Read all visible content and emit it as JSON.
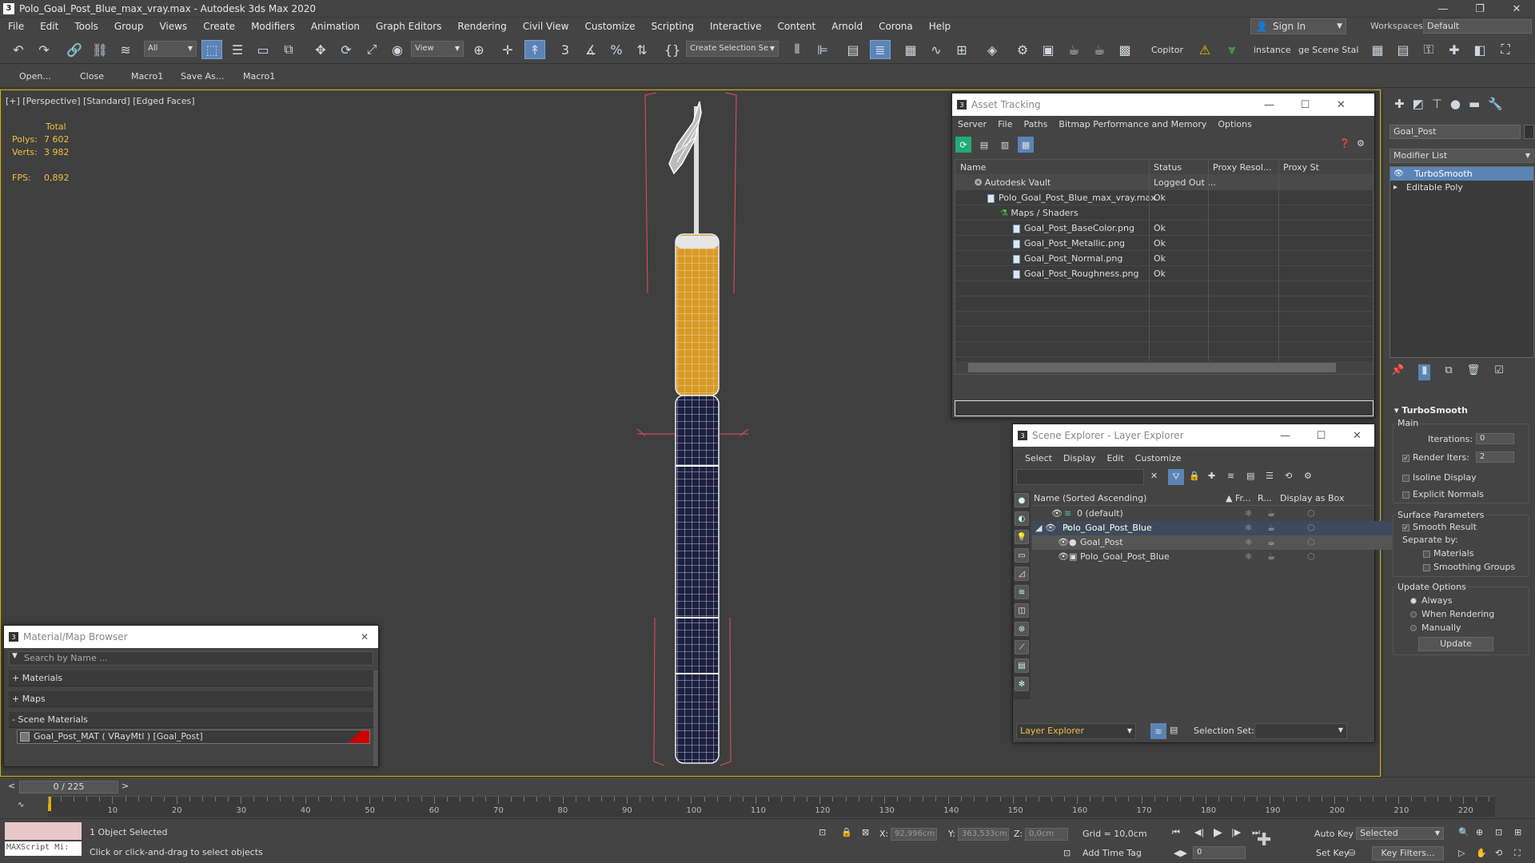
{
  "window": {
    "title": "Polo_Goal_Post_Blue_max_vray.max - Autodesk 3ds Max 2020",
    "app_icon": "3"
  },
  "menu": [
    "File",
    "Edit",
    "Tools",
    "Group",
    "Views",
    "Create",
    "Modifiers",
    "Animation",
    "Graph Editors",
    "Rendering",
    "Civil View",
    "Customize",
    "Scripting",
    "Interactive",
    "Content",
    "Arnold",
    "Corona",
    "Help"
  ],
  "signin": {
    "label": "Sign In"
  },
  "workspaces": {
    "label": "Workspaces:",
    "value": "Default"
  },
  "toolbar": {
    "filter": "All",
    "view": "View",
    "selection_set": "Create Selection Se",
    "copitor": "Copitor",
    "instance": "instance",
    "scene_stat": "ge Scene Stal"
  },
  "toolbar2": [
    "Open...",
    "Close",
    "Macro1",
    "Save As...",
    "Macro1"
  ],
  "viewport": {
    "label": "[+] [Perspective] [Standard] [Edged Faces]",
    "stats": {
      "total_label": "Total",
      "polys_label": "Polys:",
      "polys": "7 602",
      "verts_label": "Verts:",
      "verts": "3 982",
      "fps_label": "FPS:",
      "fps": "0,892"
    }
  },
  "asset_tracking": {
    "title": "Asset Tracking",
    "menu": [
      "Server",
      "File",
      "Paths",
      "Bitmap Performance and Memory",
      "Options"
    ],
    "columns": [
      "Name",
      "Status",
      "Proxy Resol...",
      "Proxy St"
    ],
    "rows": [
      {
        "name": "Autodesk Vault",
        "status": "Logged Out ...",
        "indent": 0
      },
      {
        "name": "Polo_Goal_Post_Blue_max_vray.max",
        "status": "Ok",
        "indent": 1
      },
      {
        "name": "Maps / Shaders",
        "status": "",
        "indent": 2
      },
      {
        "name": "Goal_Post_BaseColor.png",
        "status": "Ok",
        "indent": 3
      },
      {
        "name": "Goal_Post_Metallic.png",
        "status": "Ok",
        "indent": 3
      },
      {
        "name": "Goal_Post_Normal.png",
        "status": "Ok",
        "indent": 3
      },
      {
        "name": "Goal_Post_Roughness.png",
        "status": "Ok",
        "indent": 3
      }
    ]
  },
  "scene_explorer": {
    "title": "Scene Explorer - Layer Explorer",
    "menu": [
      "Select",
      "Display",
      "Edit",
      "Customize"
    ],
    "columns": [
      "Name (Sorted Ascending)",
      "▲ Fr...",
      "R...",
      "Display as Box"
    ],
    "rows": [
      {
        "name": "0 (default)",
        "indent": 1,
        "selected": false
      },
      {
        "name": "Polo_Goal_Post_Blue",
        "indent": 1,
        "selected": true
      },
      {
        "name": "Goal_Post",
        "indent": 2,
        "selected": false,
        "highlight": true
      },
      {
        "name": "Polo_Goal_Post_Blue",
        "indent": 2,
        "selected": false
      }
    ],
    "footer_label": "Layer Explorer",
    "selection_set_label": "Selection Set:"
  },
  "material_browser": {
    "title": "Material/Map Browser",
    "search_placeholder": "Search by Name ...",
    "sections": [
      "+ Materials",
      "+ Maps",
      "- Scene Materials"
    ],
    "material": "Goal_Post_MAT ( VRayMtl ) [Goal_Post]"
  },
  "command_panel": {
    "object_name": "Goal_Post",
    "modifier_list": "Modifier List",
    "stack": [
      "TurboSmooth",
      "Editable Poly"
    ],
    "turbosmooth": {
      "header": "TurboSmooth",
      "main": "Main",
      "iterations_label": "Iterations:",
      "iterations": "0",
      "render_iters_label": "Render Iters:",
      "render_iters": "2",
      "isoline": "Isoline Display",
      "explicit": "Explicit Normals",
      "surface": "Surface Parameters",
      "smooth": "Smooth Result",
      "separate": "Separate by:",
      "materials": "Materials",
      "smoothing": "Smoothing Groups",
      "update_options": "Update Options",
      "always": "Always",
      "when_rendering": "When Rendering",
      "manually": "Manually",
      "update_btn": "Update"
    }
  },
  "timeline": {
    "frame": "0 / 225",
    "ticks": [
      "10",
      "20",
      "30",
      "40",
      "50",
      "60",
      "70",
      "80",
      "90",
      "100",
      "110",
      "120",
      "130",
      "140",
      "150",
      "160",
      "170",
      "180",
      "190",
      "200",
      "210",
      "220"
    ]
  },
  "status": {
    "maxscript": "MAXScript Mi:",
    "selected": "1 Object Selected",
    "prompt": "Click or click-and-drag to select objects",
    "x_label": "X:",
    "x": "92,996cm",
    "y_label": "Y:",
    "y": "363,533cm",
    "z_label": "Z:",
    "z": "0,0cm",
    "grid": "Grid = 10,0cm",
    "add_time_tag": "Add Time Tag",
    "auto_key": "Auto Key",
    "set_key": "Set Key",
    "selected_drop": "Selected",
    "key_filters": "Key Filters...",
    "frame_field": "0"
  },
  "colors": {
    "accent": "#5b84b6",
    "viewport_border": "#e0b000",
    "stats": "#f0c040",
    "wire_white": "#ffffff",
    "wire_yellow": "#e0a020",
    "wire_navy": "#1c2040",
    "bbox": "#e05060"
  }
}
